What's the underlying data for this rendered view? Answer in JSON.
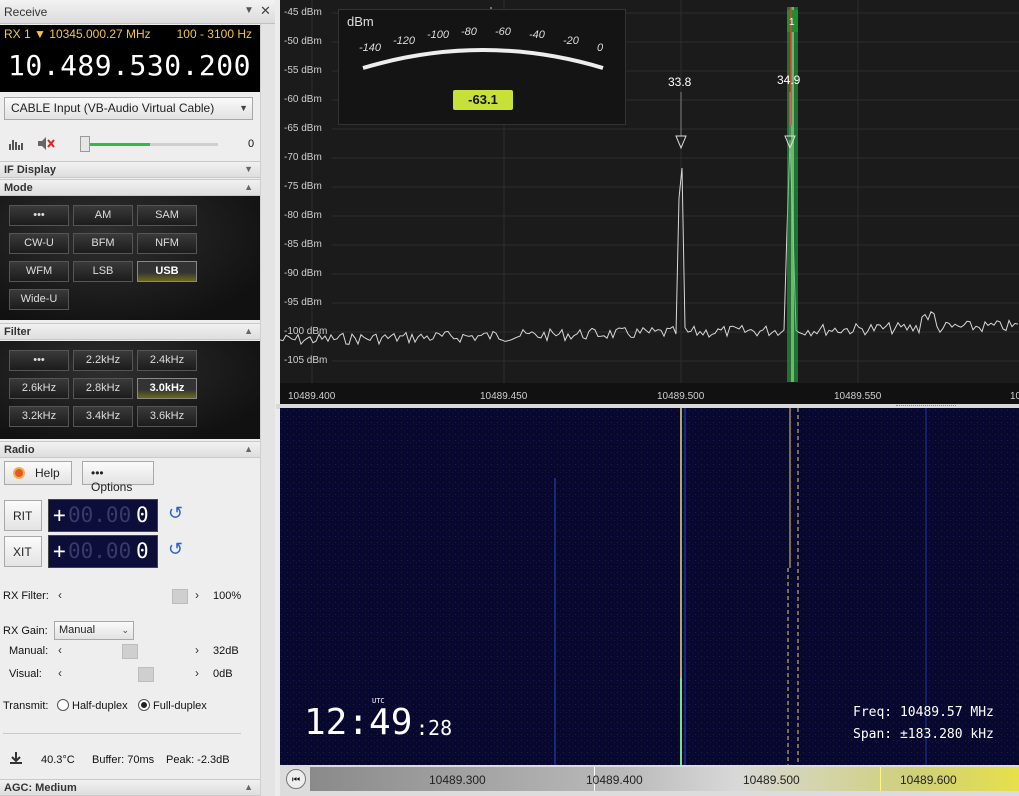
{
  "panel": {
    "title": "Receive"
  },
  "rx": {
    "id": "RX 1",
    "freq_small": "10345.000.27 MHz",
    "bandwidth": "100 - 3100 Hz",
    "freq_big": "10.489.530.200"
  },
  "audio": {
    "device": "CABLE Input (VB-Audio Virtual Cable)",
    "volume": "0",
    "volume_level": 0.05
  },
  "sections": {
    "if_display": "IF Display",
    "mode": "Mode",
    "filter": "Filter",
    "radio": "Radio",
    "agc": "AGC: Medium"
  },
  "modes": [
    {
      "label": "•••"
    },
    {
      "label": "AM"
    },
    {
      "label": "SAM"
    },
    {
      "label": "CW-U"
    },
    {
      "label": "BFM"
    },
    {
      "label": "NFM"
    },
    {
      "label": "WFM"
    },
    {
      "label": "LSB"
    },
    {
      "label": "USB"
    },
    {
      "label": "Wide-U"
    }
  ],
  "filters": [
    {
      "label": "•••"
    },
    {
      "label": "2.2kHz"
    },
    {
      "label": "2.4kHz"
    },
    {
      "label": "2.6kHz"
    },
    {
      "label": "2.8kHz"
    },
    {
      "label": "3.0kHz"
    },
    {
      "label": "3.2kHz"
    },
    {
      "label": "3.4kHz"
    },
    {
      "label": "3.6kHz"
    }
  ],
  "radio": {
    "help": "Help",
    "options": "Options",
    "rit": "RIT",
    "xit": "XIT",
    "lcd_plus": "+",
    "lcd_dim": "00.00",
    "lcd_last": "0",
    "rx_filter_label": "RX Filter:",
    "rx_filter_value": "100%",
    "rx_gain_label": "RX Gain:",
    "rx_gain_mode": "Manual",
    "manual_label": "Manual:",
    "manual_value": "32dB",
    "visual_label": "Visual:",
    "visual_value": "0dB",
    "transmit_label": "Transmit:",
    "half_duplex": "Half-duplex",
    "full_duplex": "Full-duplex"
  },
  "status": {
    "temp": "40.3°C",
    "buffer": "Buffer: 70ms",
    "peak": "Peak: -2.3dB"
  },
  "spectrum": {
    "y_labels": [
      "-45 dBm",
      "-50 dBm",
      "-55 dBm",
      "-60 dBm",
      "-65 dBm",
      "-70 dBm",
      "-75 dBm",
      "-80 dBm",
      "-85 dBm",
      "-90 dBm",
      "-95 dBm",
      "-100 dBm",
      "-105 dBm"
    ],
    "x_labels": [
      "10489.400",
      "10489.450",
      "10489.500",
      "10489.550",
      "10"
    ],
    "marker1": "33.8",
    "marker2": "34.9",
    "channel": "1"
  },
  "smeter": {
    "unit": "dBm",
    "scale": [
      "-140",
      "-120",
      "-100",
      "-80",
      "-60",
      "-40",
      "-20",
      "0"
    ],
    "value": "-63.1"
  },
  "waterfall": {
    "clock_hm": "12:49",
    "clock_s": ":28",
    "clock_tz": "UTC",
    "freq": "Freq: 10489.57 MHz",
    "span": "Span: ±183.280 kHz",
    "bottom_labels": [
      "10489.300",
      "10489.400",
      "10489.500",
      "10489.600"
    ]
  }
}
